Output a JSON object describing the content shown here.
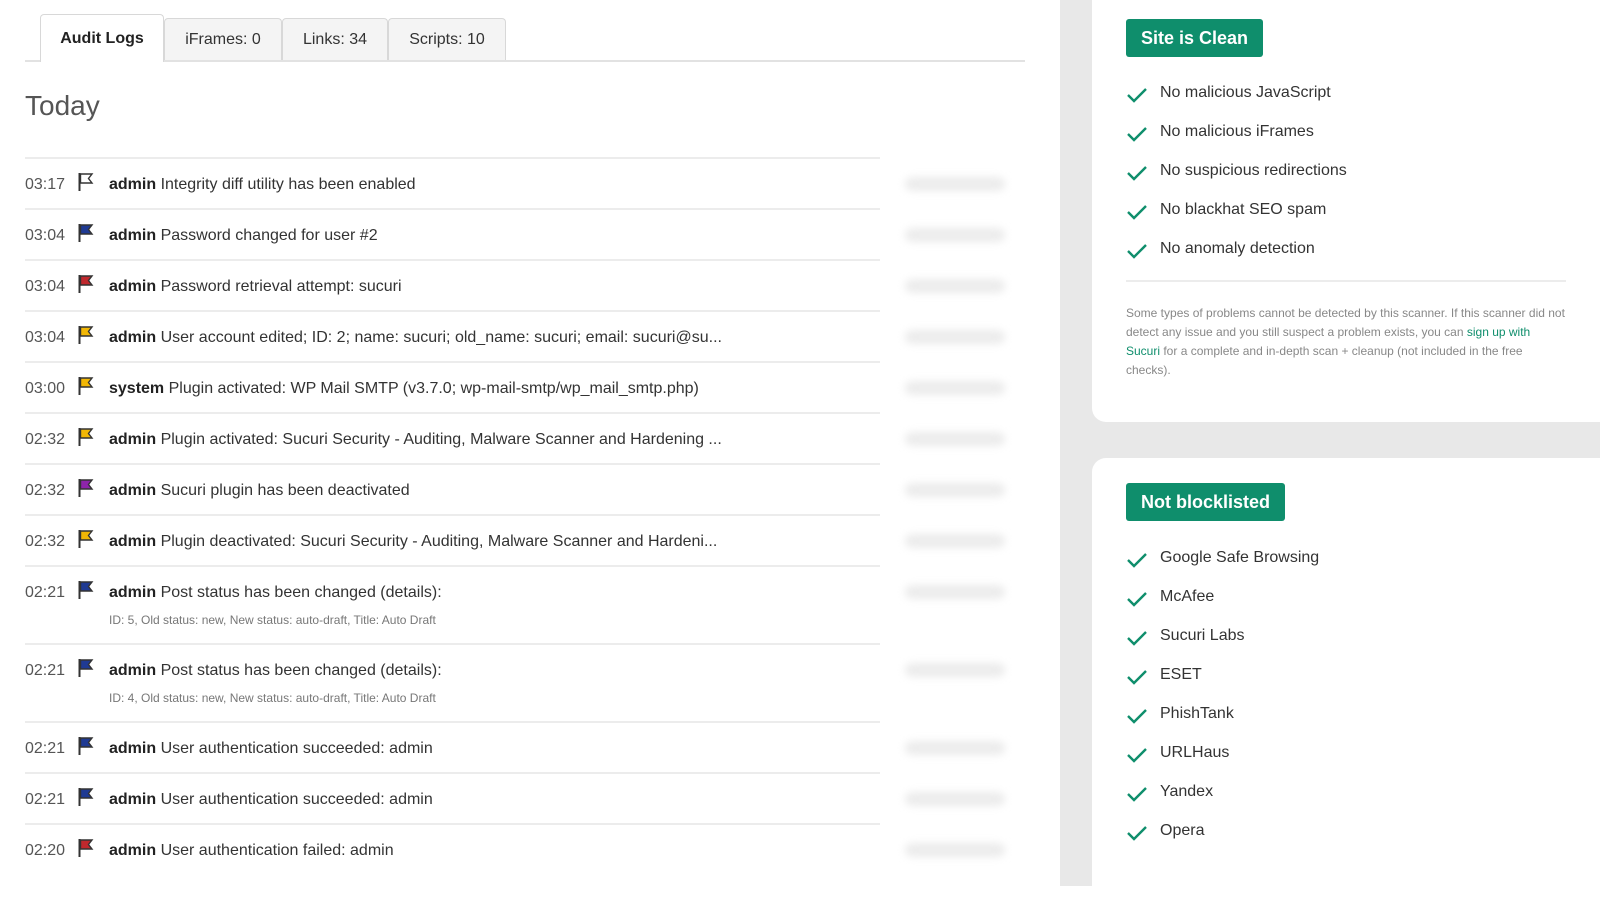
{
  "tabs": [
    {
      "label": "Audit Logs",
      "active": true
    },
    {
      "label": "iFrames: 0",
      "active": false
    },
    {
      "label": "Links: 34",
      "active": false
    },
    {
      "label": "Scripts: 10",
      "active": false
    }
  ],
  "section_title": "Today",
  "logs": [
    {
      "time": "03:17",
      "flag": "white",
      "user": "admin",
      "message": "Integrity diff utility has been enabled"
    },
    {
      "time": "03:04",
      "flag": "blue",
      "user": "admin",
      "message": "Password changed for user #2"
    },
    {
      "time": "03:04",
      "flag": "red",
      "user": "admin",
      "message": "Password retrieval attempt: sucuri"
    },
    {
      "time": "03:04",
      "flag": "yellow",
      "user": "admin",
      "message": "User account edited; ID: 2; name: sucuri; old_name: sucuri; email: sucuri@su..."
    },
    {
      "time": "03:00",
      "flag": "yellow",
      "user": "system",
      "message": "Plugin activated: WP Mail SMTP (v3.7.0; wp-mail-smtp/wp_mail_smtp.php)"
    },
    {
      "time": "02:32",
      "flag": "yellow",
      "user": "admin",
      "message": "Plugin activated: Sucuri Security - Auditing, Malware Scanner and Hardening ..."
    },
    {
      "time": "02:32",
      "flag": "purple",
      "user": "admin",
      "message": "Sucuri plugin has been deactivated"
    },
    {
      "time": "02:32",
      "flag": "yellow",
      "user": "admin",
      "message": "Plugin deactivated: Sucuri Security - Auditing, Malware Scanner and Hardeni..."
    },
    {
      "time": "02:21",
      "flag": "blue",
      "user": "admin",
      "message": "Post status has been changed (details):",
      "details": "ID: 5, Old status: new, New status: auto-draft, Title: Auto Draft"
    },
    {
      "time": "02:21",
      "flag": "blue",
      "user": "admin",
      "message": "Post status has been changed (details):",
      "details": "ID: 4, Old status: new, New status: auto-draft, Title: Auto Draft"
    },
    {
      "time": "02:21",
      "flag": "blue",
      "user": "admin",
      "message": "User authentication succeeded: admin"
    },
    {
      "time": "02:21",
      "flag": "blue",
      "user": "admin",
      "message": "User authentication succeeded: admin"
    },
    {
      "time": "02:20",
      "flag": "red",
      "user": "admin",
      "message": "User authentication failed: admin"
    }
  ],
  "flag_colors": {
    "white": "#ffffff",
    "blue": "#1f3a93",
    "red": "#c0282d",
    "yellow": "#f2b705",
    "purple": "#8e24aa"
  },
  "clean_card": {
    "badge": "Site is Clean",
    "checks": [
      "No malicious JavaScript",
      "No malicious iFrames",
      "No suspicious redirections",
      "No blackhat SEO spam",
      "No anomaly detection"
    ],
    "note_before": "Some types of problems cannot be detected by this scanner. If this scanner did not detect any issue and you still suspect a problem exists, you can ",
    "note_link": "sign up with Sucuri",
    "note_after": " for a complete and in-depth scan + cleanup (not included in the free checks)."
  },
  "blocklist_card": {
    "badge": "Not blocklisted",
    "checks": [
      "Google Safe Browsing",
      "McAfee",
      "Sucuri Labs",
      "ESET",
      "PhishTank",
      "URLHaus",
      "Yandex",
      "Opera"
    ]
  },
  "colors": {
    "accent": "#0f8e6c",
    "gutter": "#e8e8e8"
  }
}
